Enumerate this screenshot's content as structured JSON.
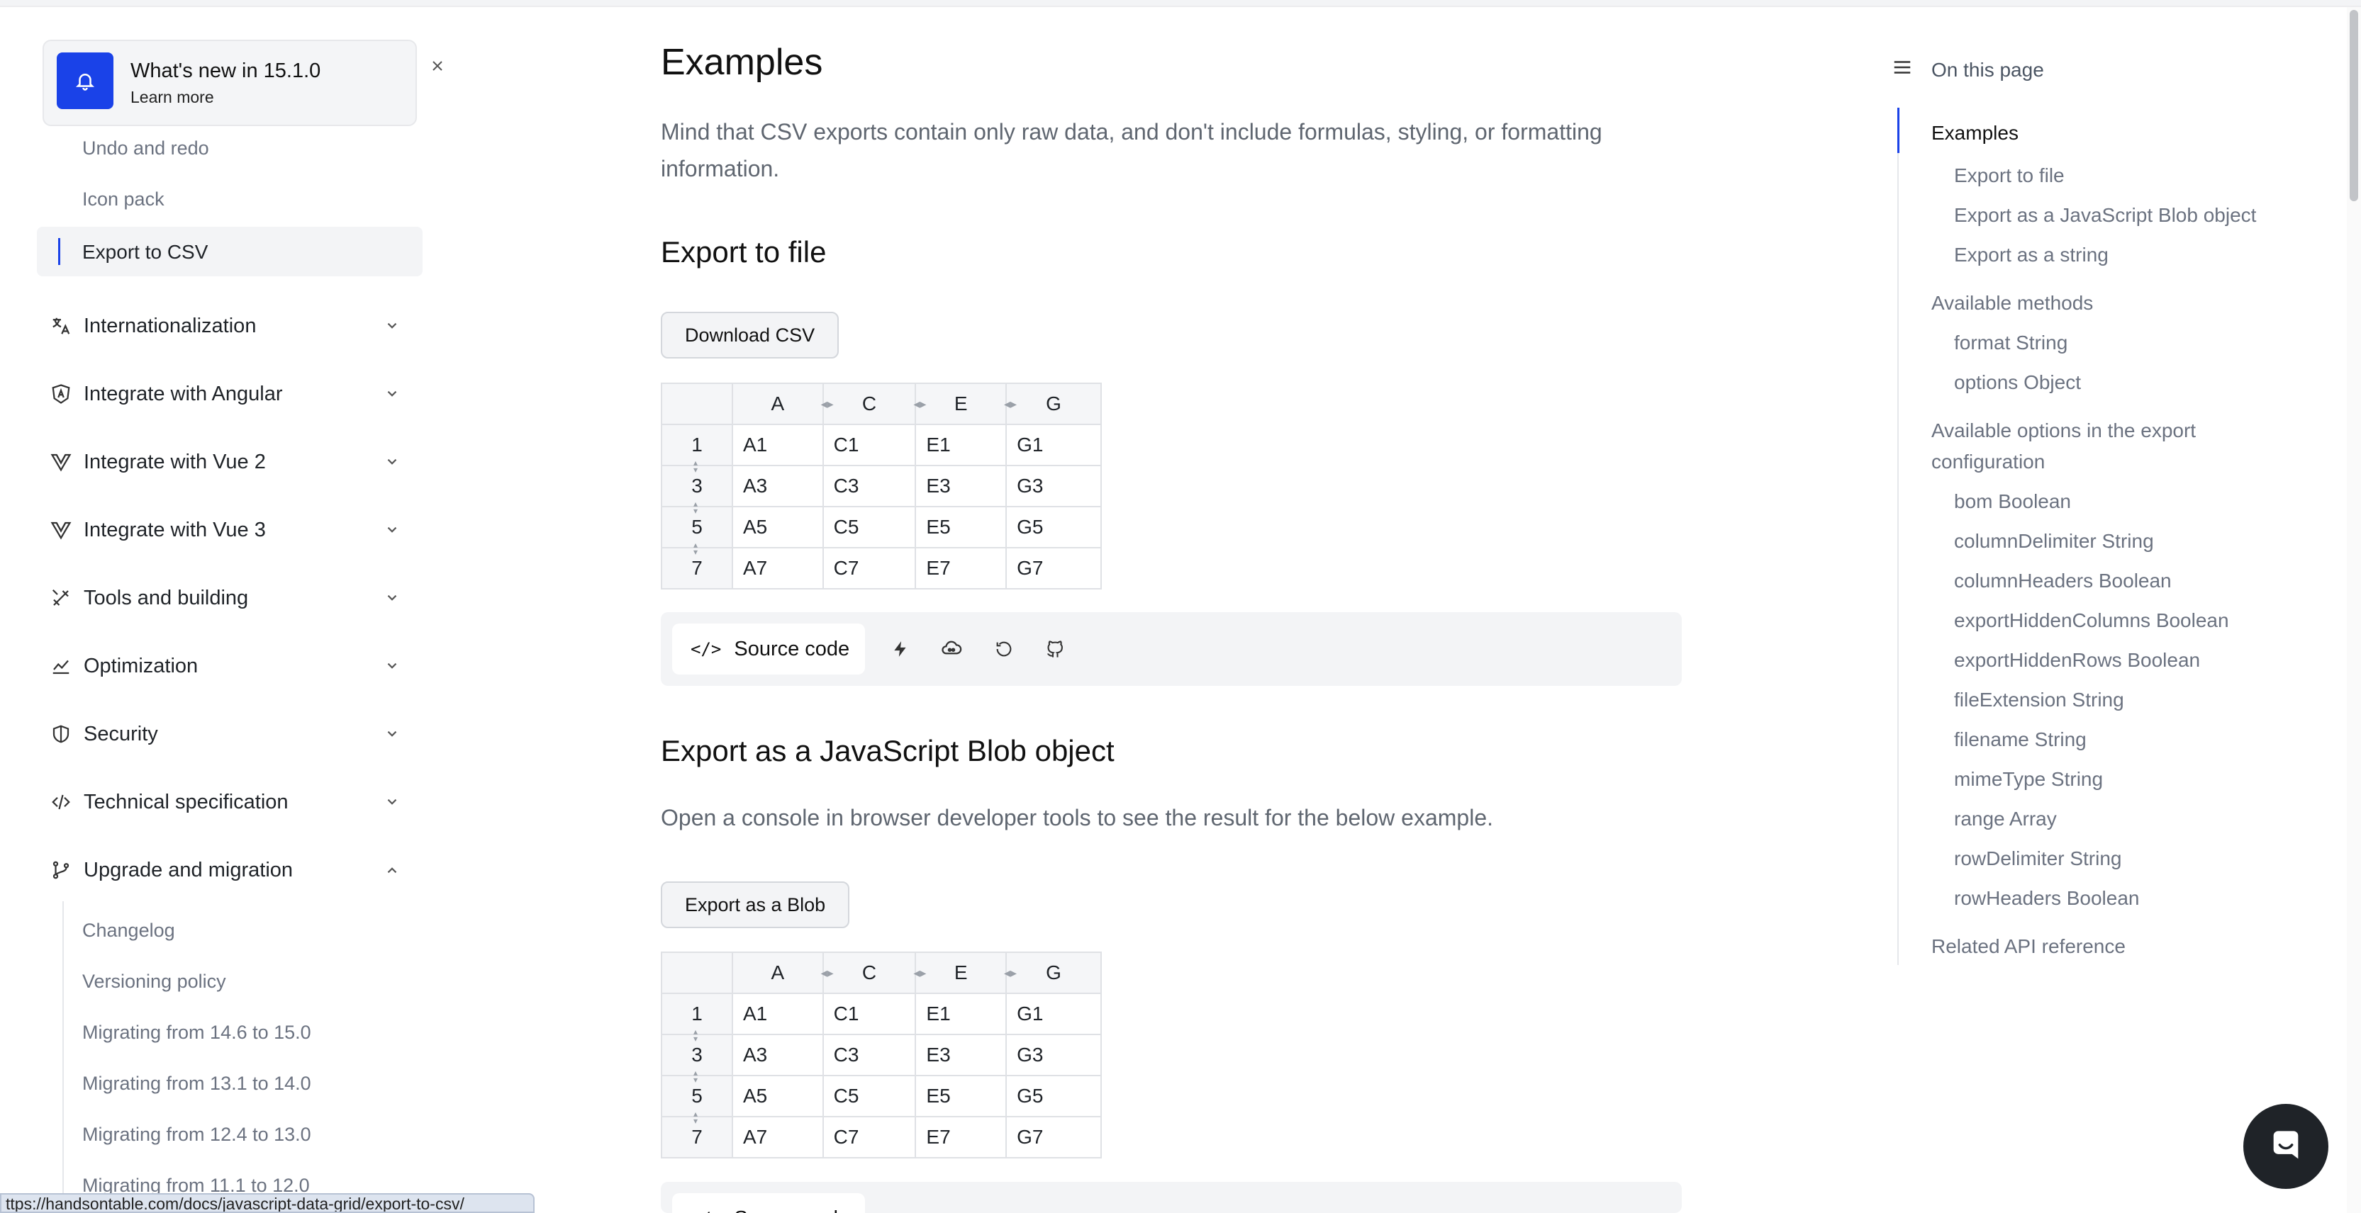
{
  "notice": {
    "title": "What's new in 15.1.0",
    "link": "Learn more"
  },
  "sidebar": {
    "sub_items_top": [
      "Undo and redo",
      "Icon pack"
    ],
    "active_item": "Export to CSV",
    "groups": [
      {
        "label": "Internationalization",
        "icon": "translate-icon",
        "expanded": false
      },
      {
        "label": "Integrate with Angular",
        "icon": "angular-icon",
        "expanded": false
      },
      {
        "label": "Integrate with Vue 2",
        "icon": "vue-icon",
        "expanded": false
      },
      {
        "label": "Integrate with Vue 3",
        "icon": "vue-icon",
        "expanded": false
      },
      {
        "label": "Tools and building",
        "icon": "tools-icon",
        "expanded": false
      },
      {
        "label": "Optimization",
        "icon": "chart-icon",
        "expanded": false
      },
      {
        "label": "Security",
        "icon": "shield-icon",
        "expanded": false
      },
      {
        "label": "Technical specification",
        "icon": "code-icon",
        "expanded": false
      },
      {
        "label": "Upgrade and migration",
        "icon": "branch-icon",
        "expanded": true
      }
    ],
    "migration_items": [
      "Changelog",
      "Versioning policy",
      "Migrating from 14.6 to 15.0",
      "Migrating from 13.1 to 14.0",
      "Migrating from 12.4 to 13.0",
      "Migrating from 11.1 to 12.0"
    ]
  },
  "status_url": "ttps://handsontable.com/docs/javascript-data-grid/export-to-csv/",
  "main": {
    "title": "Examples",
    "intro": "Mind that CSV exports contain only raw data, and don't include formulas, styling, or formatting information.",
    "section1": {
      "heading": "Export to file",
      "button": "Download CSV"
    },
    "section2": {
      "heading": "Export as a JavaScript Blob object",
      "text": "Open a console in browser developer tools to see the result for the below example.",
      "button": "Export as a Blob"
    },
    "grid": {
      "columns": [
        "A",
        "C",
        "E",
        "G"
      ],
      "rows": [
        {
          "header": "1",
          "cells": [
            "A1",
            "C1",
            "E1",
            "G1"
          ]
        },
        {
          "header": "3",
          "cells": [
            "A3",
            "C3",
            "E3",
            "G3"
          ]
        },
        {
          "header": "5",
          "cells": [
            "A5",
            "C5",
            "E5",
            "G5"
          ]
        },
        {
          "header": "7",
          "cells": [
            "A7",
            "C7",
            "E7",
            "G7"
          ]
        }
      ]
    },
    "toolbar": {
      "source_label": "Source code"
    }
  },
  "toc": {
    "heading": "On this page",
    "items": [
      {
        "label": "Examples",
        "level": 1,
        "active": true
      },
      {
        "label": "Export to file",
        "level": 2
      },
      {
        "label": "Export as a JavaScript Blob object",
        "level": 2
      },
      {
        "label": "Export as a string",
        "level": 2
      },
      {
        "label": "Available methods",
        "level": 1
      },
      {
        "label": "format String",
        "level": 2
      },
      {
        "label": "options Object",
        "level": 2
      },
      {
        "label": "Available options in the export configuration",
        "level": 1
      },
      {
        "label": "bom Boolean",
        "level": 2
      },
      {
        "label": "columnDelimiter String",
        "level": 2
      },
      {
        "label": "columnHeaders Boolean",
        "level": 2
      },
      {
        "label": "exportHiddenColumns Boolean",
        "level": 2
      },
      {
        "label": "exportHiddenRows Boolean",
        "level": 2
      },
      {
        "label": "fileExtension String",
        "level": 2
      },
      {
        "label": "filename String",
        "level": 2
      },
      {
        "label": "mimeType String",
        "level": 2
      },
      {
        "label": "range Array",
        "level": 2
      },
      {
        "label": "rowDelimiter String",
        "level": 2
      },
      {
        "label": "rowHeaders Boolean",
        "level": 2
      },
      {
        "label": "Related API reference",
        "level": 1
      }
    ]
  },
  "colors": {
    "accent": "#1a42e8",
    "text": "#1f2328",
    "muted": "#6b7280",
    "panel": "#f3f4f6"
  }
}
